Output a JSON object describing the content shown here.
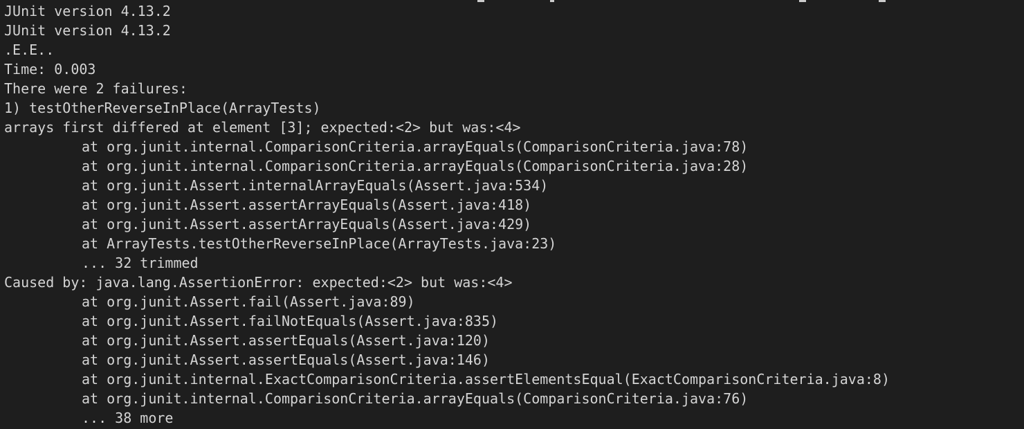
{
  "terminal": {
    "output": {
      "lines": [
        {
          "text": "JUnit version 4.13.2",
          "indent": false
        },
        {
          "text": "JUnit version 4.13.2",
          "indent": false
        },
        {
          "text": ".E.E..",
          "indent": false
        },
        {
          "text": "Time: 0.003",
          "indent": false
        },
        {
          "text": "There were 2 failures:",
          "indent": false
        },
        {
          "text": "1) testOtherReverseInPlace(ArrayTests)",
          "indent": false
        },
        {
          "text": "arrays first differed at element [3]; expected:<2> but was:<4>",
          "indent": false
        },
        {
          "text": "at org.junit.internal.ComparisonCriteria.arrayEquals(ComparisonCriteria.java:78)",
          "indent": true
        },
        {
          "text": "at org.junit.internal.ComparisonCriteria.arrayEquals(ComparisonCriteria.java:28)",
          "indent": true
        },
        {
          "text": "at org.junit.Assert.internalArrayEquals(Assert.java:534)",
          "indent": true
        },
        {
          "text": "at org.junit.Assert.assertArrayEquals(Assert.java:418)",
          "indent": true
        },
        {
          "text": "at org.junit.Assert.assertArrayEquals(Assert.java:429)",
          "indent": true
        },
        {
          "text": "at ArrayTests.testOtherReverseInPlace(ArrayTests.java:23)",
          "indent": true
        },
        {
          "text": "... 32 trimmed",
          "indent": true
        },
        {
          "text": "Caused by: java.lang.AssertionError: expected:<2> but was:<4>",
          "indent": false
        },
        {
          "text": "at org.junit.Assert.fail(Assert.java:89)",
          "indent": true
        },
        {
          "text": "at org.junit.Assert.failNotEquals(Assert.java:835)",
          "indent": true
        },
        {
          "text": "at org.junit.Assert.assertEquals(Assert.java:120)",
          "indent": true
        },
        {
          "text": "at org.junit.Assert.assertEquals(Assert.java:146)",
          "indent": true
        },
        {
          "text": "at org.junit.internal.ExactComparisonCriteria.assertElementsEqual(ExactComparisonCriteria.java:8)",
          "indent": true
        },
        {
          "text": "at org.junit.internal.ComparisonCriteria.arrayEquals(ComparisonCriteria.java:76)",
          "indent": true
        },
        {
          "text": "... 38 more",
          "indent": true
        }
      ]
    },
    "colors": {
      "background": "#1e1e1e",
      "text": "#d4d4d4"
    }
  }
}
